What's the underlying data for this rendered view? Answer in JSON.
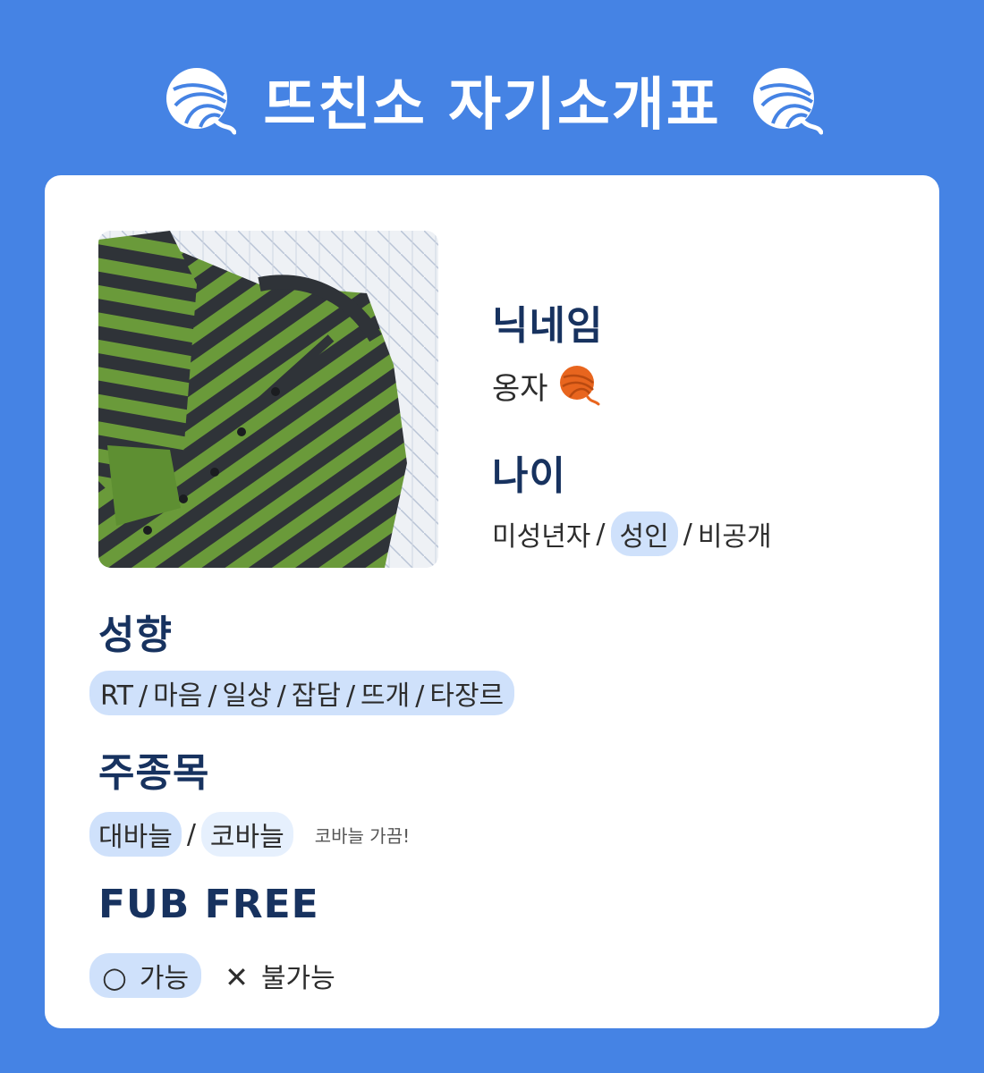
{
  "header": {
    "title": "뜨친소 자기소개표",
    "icon": "yarn-ball-icon"
  },
  "colors": {
    "background": "#4583e4",
    "card": "#ffffff",
    "label": "#17325f",
    "highlight": "#cfe1fb",
    "sweater_green": "#6a9a3a",
    "sweater_dark": "#2f3338"
  },
  "profile": {
    "photo_alt": "green and charcoal striped knitted cardigan",
    "nickname_label": "닉네임",
    "nickname_value": "옹자",
    "nickname_emoji": "yarn-ball-emoji",
    "age_label": "나이",
    "age_options": [
      "미성년자",
      "성인",
      "비공개"
    ],
    "age_selected": "성인"
  },
  "tendency": {
    "label": "성향",
    "items": [
      "RT",
      "마음",
      "일상",
      "잡담",
      "뜨개",
      "타장르"
    ]
  },
  "main_type": {
    "label": "주종목",
    "options": [
      "대바늘",
      "코바늘"
    ],
    "selected": "대바늘",
    "note": "코바늘 가끔!"
  },
  "fub_free": {
    "label": "FUB FREE",
    "yes_symbol": "○",
    "yes_label": "가능",
    "no_symbol": "✕",
    "no_label": "불가능",
    "selected": "가능"
  }
}
